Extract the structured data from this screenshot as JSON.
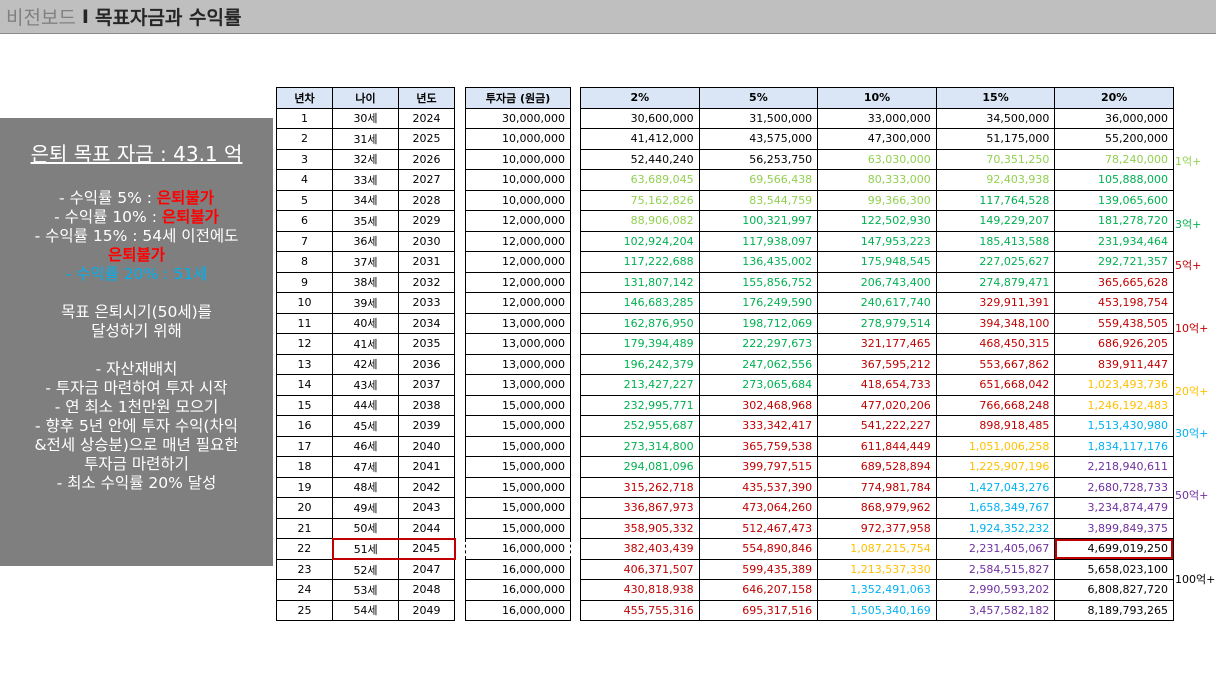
{
  "title": {
    "section": "비전보드",
    "separator": "I",
    "topic": "목표자금과 수익률"
  },
  "panel": {
    "goal": "은퇴 목표 자금 : 43.1 억",
    "rows": [
      {
        "text": "- 수익률 5% : ",
        "red": "은퇴불가"
      },
      {
        "text": "- 수익률 10% : ",
        "red": "은퇴불가"
      },
      {
        "text": "- 수익률 15% : 54세 이전에도",
        "red": ""
      },
      {
        "text": "",
        "red": "은퇴불가"
      }
    ],
    "blue_line": "- 수익률 20% : 51세",
    "target_1": "목표 은퇴시기(50세)를",
    "target_2": "달성하기 위해",
    "plan": [
      "- 자산재배치",
      "-    투자금 마련하여 투자 시작",
      "- 연 최소 1천만원 모으기",
      "- 향후 5년 안에 투자 수익(차익",
      "&전세 상승분)으로 매년 필요한",
      "투자금 마련하기",
      "- 최소 수익률 20% 달성"
    ]
  },
  "headers": {
    "year_no": "년차",
    "age": "나이",
    "year": "년도",
    "invest": "투자금 (원금)",
    "rates": [
      "2%",
      "5%",
      "10%",
      "15%",
      "20%"
    ]
  },
  "rows": [
    {
      "n": "1",
      "age": "30세",
      "year": "2024",
      "invest": "30,000,000",
      "r": [
        "30,600,000",
        "31,500,000",
        "33,000,000",
        "34,500,000",
        "36,000,000"
      ]
    },
    {
      "n": "2",
      "age": "31세",
      "year": "2025",
      "invest": "10,000,000",
      "r": [
        "41,412,000",
        "43,575,000",
        "47,300,000",
        "51,175,000",
        "55,200,000"
      ]
    },
    {
      "n": "3",
      "age": "32세",
      "year": "2026",
      "invest": "10,000,000",
      "r": [
        "52,440,240",
        "56,253,750",
        "63,030,000",
        "70,351,250",
        "78,240,000"
      ]
    },
    {
      "n": "4",
      "age": "33세",
      "year": "2027",
      "invest": "10,000,000",
      "r": [
        "63,689,045",
        "69,566,438",
        "80,333,000",
        "92,403,938",
        "105,888,000"
      ]
    },
    {
      "n": "5",
      "age": "34세",
      "year": "2028",
      "invest": "10,000,000",
      "r": [
        "75,162,826",
        "83,544,759",
        "99,366,300",
        "117,764,528",
        "139,065,600"
      ]
    },
    {
      "n": "6",
      "age": "35세",
      "year": "2029",
      "invest": "12,000,000",
      "r": [
        "88,906,082",
        "100,321,997",
        "122,502,930",
        "149,229,207",
        "181,278,720"
      ]
    },
    {
      "n": "7",
      "age": "36세",
      "year": "2030",
      "invest": "12,000,000",
      "r": [
        "102,924,204",
        "117,938,097",
        "147,953,223",
        "185,413,588",
        "231,934,464"
      ]
    },
    {
      "n": "8",
      "age": "37세",
      "year": "2031",
      "invest": "12,000,000",
      "r": [
        "117,222,688",
        "136,435,002",
        "175,948,545",
        "227,025,627",
        "292,721,357"
      ]
    },
    {
      "n": "9",
      "age": "38세",
      "year": "2032",
      "invest": "12,000,000",
      "r": [
        "131,807,142",
        "155,856,752",
        "206,743,400",
        "274,879,471",
        "365,665,628"
      ]
    },
    {
      "n": "10",
      "age": "39세",
      "year": "2033",
      "invest": "12,000,000",
      "r": [
        "146,683,285",
        "176,249,590",
        "240,617,740",
        "329,911,391",
        "453,198,754"
      ]
    },
    {
      "n": "11",
      "age": "40세",
      "year": "2034",
      "invest": "13,000,000",
      "r": [
        "162,876,950",
        "198,712,069",
        "278,979,514",
        "394,348,100",
        "559,438,505"
      ]
    },
    {
      "n": "12",
      "age": "41세",
      "year": "2035",
      "invest": "13,000,000",
      "r": [
        "179,394,489",
        "222,297,673",
        "321,177,465",
        "468,450,315",
        "686,926,205"
      ]
    },
    {
      "n": "13",
      "age": "42세",
      "year": "2036",
      "invest": "13,000,000",
      "r": [
        "196,242,379",
        "247,062,556",
        "367,595,212",
        "553,667,862",
        "839,911,447"
      ]
    },
    {
      "n": "14",
      "age": "43세",
      "year": "2037",
      "invest": "13,000,000",
      "r": [
        "213,427,227",
        "273,065,684",
        "418,654,733",
        "651,668,042",
        "1,023,493,736"
      ]
    },
    {
      "n": "15",
      "age": "44세",
      "year": "2038",
      "invest": "15,000,000",
      "r": [
        "232,995,771",
        "302,468,968",
        "477,020,206",
        "766,668,248",
        "1,246,192,483"
      ]
    },
    {
      "n": "16",
      "age": "45세",
      "year": "2039",
      "invest": "15,000,000",
      "r": [
        "252,955,687",
        "333,342,417",
        "541,222,227",
        "898,918,485",
        "1,513,430,980"
      ]
    },
    {
      "n": "17",
      "age": "46세",
      "year": "2040",
      "invest": "15,000,000",
      "r": [
        "273,314,800",
        "365,759,538",
        "611,844,449",
        "1,051,006,258",
        "1,834,117,176"
      ]
    },
    {
      "n": "18",
      "age": "47세",
      "year": "2041",
      "invest": "15,000,000",
      "r": [
        "294,081,096",
        "399,797,515",
        "689,528,894",
        "1,225,907,196",
        "2,218,940,611"
      ]
    },
    {
      "n": "19",
      "age": "48세",
      "year": "2042",
      "invest": "15,000,000",
      "r": [
        "315,262,718",
        "435,537,390",
        "774,981,784",
        "1,427,043,276",
        "2,680,728,733"
      ]
    },
    {
      "n": "20",
      "age": "49세",
      "year": "2043",
      "invest": "15,000,000",
      "r": [
        "336,867,973",
        "473,064,260",
        "868,979,962",
        "1,658,349,767",
        "3,234,874,479"
      ]
    },
    {
      "n": "21",
      "age": "50세",
      "year": "2044",
      "invest": "15,000,000",
      "r": [
        "358,905,332",
        "512,467,473",
        "972,377,958",
        "1,924,352,232",
        "3,899,849,375"
      ]
    },
    {
      "n": "22",
      "age": "51세",
      "year": "2045",
      "invest": "16,000,000",
      "r": [
        "382,403,439",
        "554,890,846",
        "1,087,215,754",
        "2,231,405,067",
        "4,699,019,250"
      ]
    },
    {
      "n": "23",
      "age": "52세",
      "year": "2047",
      "invest": "16,000,000",
      "r": [
        "406,371,507",
        "599,435,389",
        "1,213,537,330",
        "2,584,515,827",
        "5,658,023,100"
      ]
    },
    {
      "n": "24",
      "age": "53세",
      "year": "2048",
      "invest": "16,000,000",
      "r": [
        "430,818,938",
        "646,207,158",
        "1,352,491,063",
        "2,990,593,202",
        "6,808,827,720"
      ]
    },
    {
      "n": "25",
      "age": "54세",
      "year": "2049",
      "invest": "16,000,000",
      "r": [
        "455,755,316",
        "695,317,516",
        "1,505,340,169",
        "3,457,582,182",
        "8,189,793,265"
      ]
    }
  ],
  "tiers": [
    {
      "min": 0,
      "color": "#000000"
    },
    {
      "min": 60000000,
      "color": "#92d050"
    },
    {
      "min": 100000000,
      "color": "#00b050"
    },
    {
      "min": 300000000,
      "color": "#c00000"
    },
    {
      "min": 1000000000,
      "color": "#ffc000"
    },
    {
      "min": 1300000000,
      "color": "#00b0f0"
    },
    {
      "min": 2000000000,
      "color": "#7030a0"
    },
    {
      "min": 4000000000,
      "color": "#000000"
    }
  ],
  "milestones": [
    {
      "label": "1억+",
      "row": 3,
      "color": "#92d050"
    },
    {
      "label": "3억+",
      "row": 6,
      "color": "#00b050"
    },
    {
      "label": "5억+",
      "row": 8,
      "color": "#c00000"
    },
    {
      "label": "10억+",
      "row": 11,
      "color": "#c00000"
    },
    {
      "label": "20억+",
      "row": 14,
      "color": "#ffc000"
    },
    {
      "label": "30억+",
      "row": 16,
      "color": "#00b0f0"
    },
    {
      "label": "50억+",
      "row": 19,
      "color": "#7030a0"
    },
    {
      "label": "100억+",
      "row": 23,
      "color": "#000000"
    }
  ],
  "highlight_row": 22
}
